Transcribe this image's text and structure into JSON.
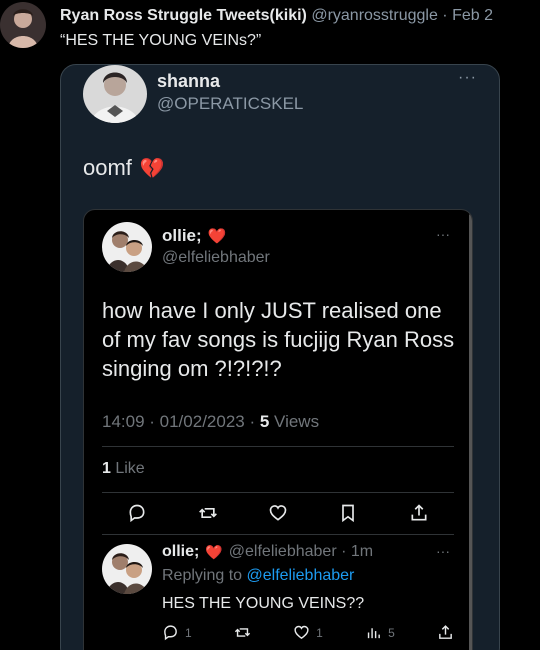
{
  "outer": {
    "name": "Ryan Ross Struggle Tweets(kiki)",
    "handle": "@ryanrosstruggle",
    "separator": "·",
    "date": "Feb 2",
    "text": "“HES THE YOUNG VEINs?”"
  },
  "quote": {
    "name": "shanna",
    "handle": "@OPERATICSKEL",
    "more": "···",
    "text": "oomf",
    "emoji": "💔"
  },
  "inner": {
    "name": "ollie;",
    "heart": "❤️",
    "handle": "@elfeliebhaber",
    "more": "···",
    "text": "how have I only JUST realised one of my fav songs is fucjijg Ryan Ross singing om ?!?!?!?",
    "time": "14:09 · 01/02/2023 · ",
    "views_count": "5",
    "views_label": " Views",
    "likes_count": "1",
    "likes_label": " Like"
  },
  "reply": {
    "name": "ollie;",
    "heart": "❤️",
    "handle_time": "@elfeliebhaber · 1m",
    "more": "···",
    "replying_prefix": "Replying to ",
    "replying_to": "@elfeliebhaber",
    "text": "HES THE YOUNG VEINS??",
    "comments": "1",
    "likes": "1",
    "views": "5"
  },
  "icons": {
    "reply": "reply-icon",
    "retweet": "retweet-icon",
    "like": "heart-icon",
    "bookmark": "bookmark-icon",
    "share": "share-icon",
    "views": "views-icon"
  },
  "colors": {
    "link": "#1d9bf0",
    "dim_card": "#15202b",
    "muted": "#71767b"
  }
}
